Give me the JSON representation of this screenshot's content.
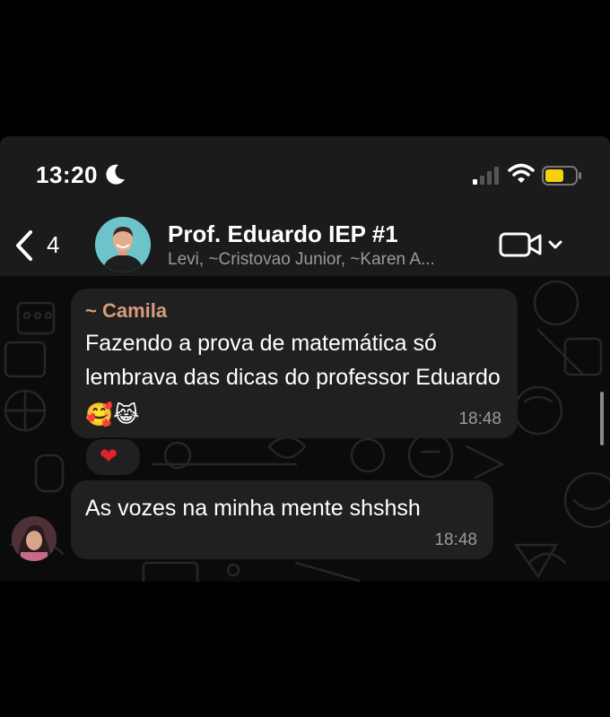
{
  "status_bar": {
    "time": "13:20",
    "icons": [
      "moon-icon",
      "signal-icon",
      "wifi-icon",
      "battery-icon"
    ],
    "battery_color": "#f5d10f"
  },
  "header": {
    "back_count": "4",
    "group_name": "Prof. Eduardo IEP #1",
    "members": "Levi, ~Cristovao Junior, ~Karen A...",
    "icons": [
      "chevron-left-icon",
      "video-call-icon",
      "chevron-down-icon"
    ]
  },
  "messages": [
    {
      "sender": "~ Camila",
      "text": "Fazendo a prova de matemática só lembrava das dicas do professor Eduardo",
      "emojis": "🥰😹",
      "time": "18:48",
      "reaction": "❤"
    },
    {
      "text": "As vozes na minha mente shshsh",
      "time": "18:48"
    }
  ],
  "colors": {
    "background": "#0b0b0b",
    "bubble": "#202020",
    "sender_name": "#d89b7b",
    "meta_text": "#9a9a9a"
  }
}
